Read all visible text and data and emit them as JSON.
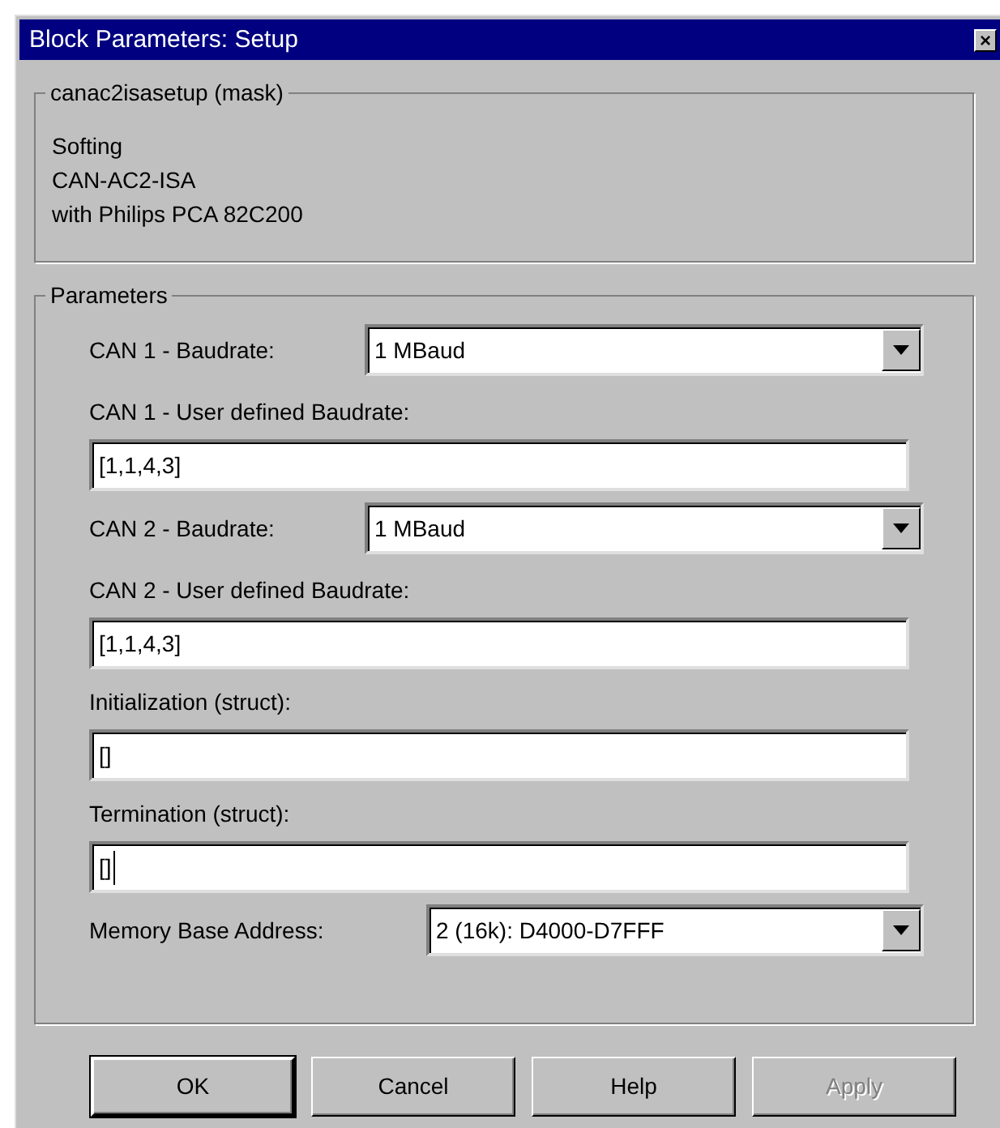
{
  "window": {
    "title": "Block Parameters: Setup",
    "close_label": "×"
  },
  "description": {
    "title": "canac2isasetup (mask)",
    "lines": [
      "Softing",
      "CAN-AC2-ISA",
      "with Philips PCA 82C200"
    ]
  },
  "parameters": {
    "title": "Parameters",
    "fields": [
      {
        "kind": "dropdown",
        "label": "CAN 1 - Baudrate:",
        "value": "1 MBaud",
        "caret": false
      },
      {
        "kind": "text",
        "label": "CAN 1 - User defined Baudrate:",
        "value": "[1,1,4,3]",
        "caret": false
      },
      {
        "kind": "dropdown",
        "label": "CAN 2 - Baudrate:",
        "value": "1 MBaud",
        "caret": false
      },
      {
        "kind": "text",
        "label": "CAN 2 - User defined Baudrate:",
        "value": "[1,1,4,3]",
        "caret": false
      },
      {
        "kind": "text",
        "label": "Initialization (struct):",
        "value": "[]",
        "caret": false
      },
      {
        "kind": "text",
        "label": "Termination (struct):",
        "value": "[]",
        "caret": true
      },
      {
        "kind": "dropdown",
        "label": "Memory Base Address:",
        "value": "2 (16k): D4000-D7FFF",
        "caret": false
      }
    ]
  },
  "buttons": [
    {
      "label": "OK",
      "default": true,
      "disabled": false
    },
    {
      "label": "Cancel",
      "default": false,
      "disabled": false
    },
    {
      "label": "Help",
      "default": false,
      "disabled": false
    },
    {
      "label": "Apply",
      "default": false,
      "disabled": true
    }
  ]
}
